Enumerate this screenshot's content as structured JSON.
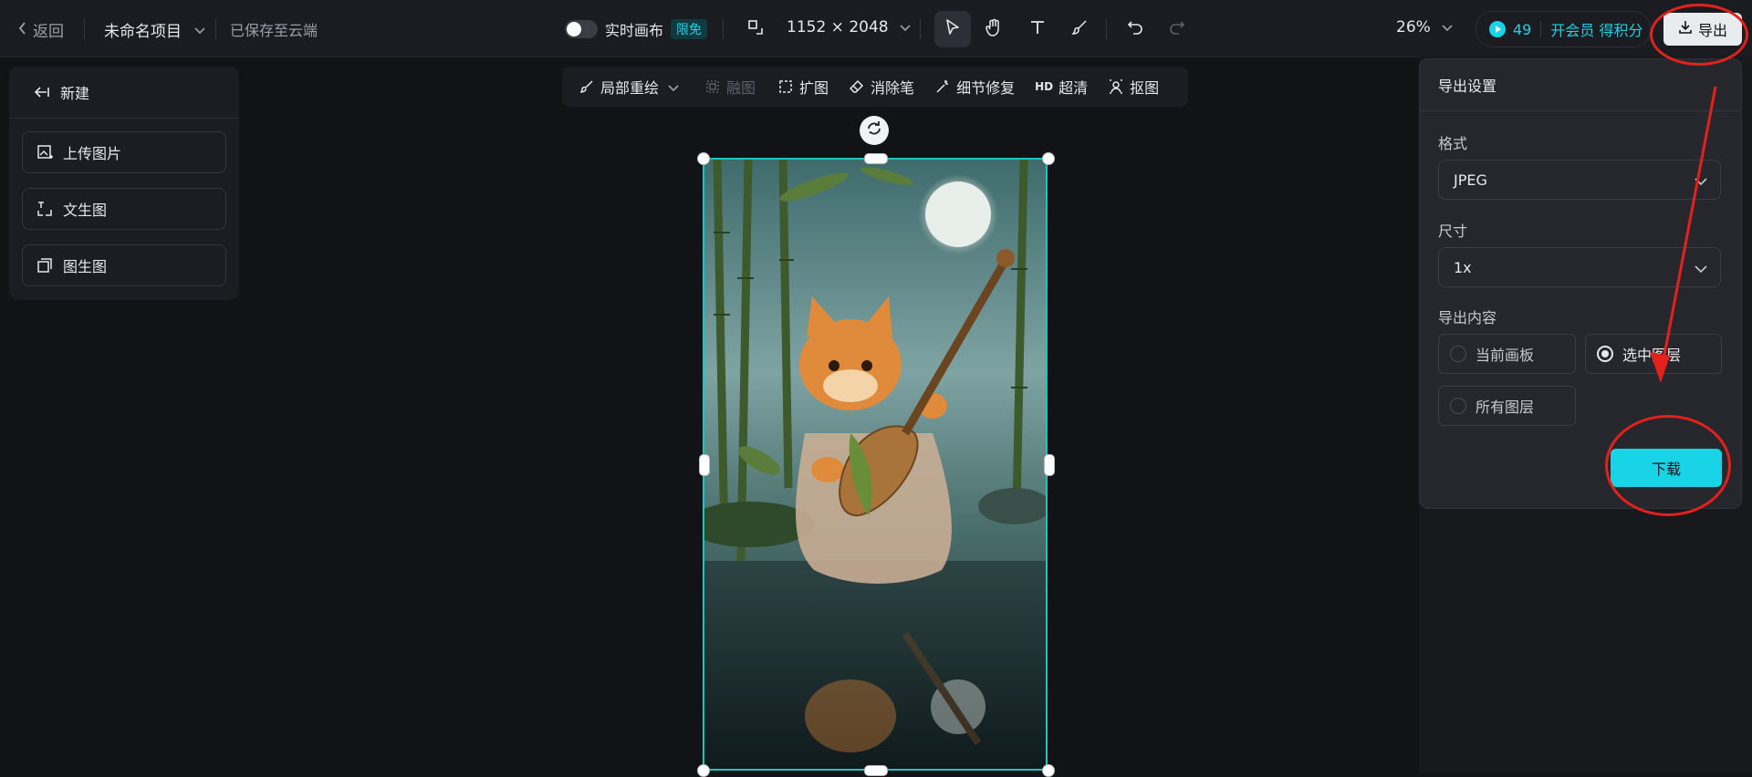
{
  "topbar": {
    "back_label": "返回",
    "project_name": "未命名项目",
    "save_status": "已保存至云端",
    "realtime_label": "实时画布",
    "realtime_badge": "限免",
    "canvas_size": "1152 × 2048",
    "zoom": "26%",
    "points_count": "49",
    "member_label": "开会员 得积分",
    "export_label": "导出"
  },
  "left_panel": {
    "new_label": "新建",
    "items": [
      {
        "label": "上传图片"
      },
      {
        "label": "文生图"
      },
      {
        "label": "图生图"
      }
    ]
  },
  "toolbar2": {
    "items": [
      {
        "label": "局部重绘",
        "icon": "brush-icon"
      },
      {
        "label": "融图",
        "icon": "blend-icon",
        "disabled": true
      },
      {
        "label": "扩图",
        "icon": "expand-icon"
      },
      {
        "label": "消除笔",
        "icon": "eraser-icon"
      },
      {
        "label": "细节修复",
        "icon": "wand-icon"
      },
      {
        "label": "超清",
        "icon": "hd-icon"
      },
      {
        "label": "抠图",
        "icon": "cutout-icon"
      }
    ]
  },
  "export_panel": {
    "title": "导出设置",
    "format_label": "格式",
    "format_value": "JPEG",
    "size_label": "尺寸",
    "size_value": "1x",
    "content_label": "导出内容",
    "options": [
      {
        "label": "当前画板",
        "checked": false
      },
      {
        "label": "选中图层",
        "checked": true
      },
      {
        "label": "所有图层",
        "checked": false
      }
    ],
    "download_label": "下载"
  },
  "colors": {
    "accent": "#19d3e6",
    "annotation": "#e2211c",
    "selection": "#19c7c2"
  }
}
